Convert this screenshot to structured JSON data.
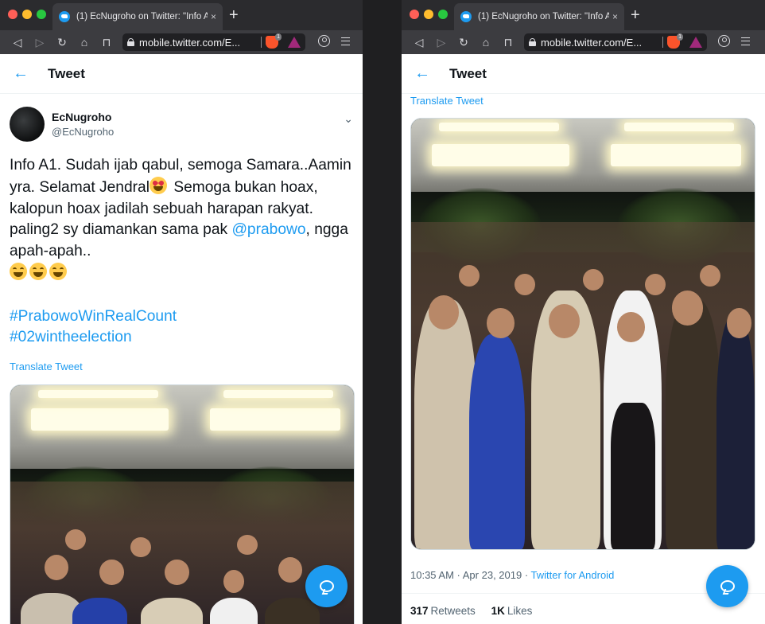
{
  "colors": {
    "twitter_blue": "#1d9bf0",
    "chrome_dark": "#2b2b2e",
    "toolbar": "#3c3c40",
    "text": "#0f1419",
    "secondary": "#536471"
  },
  "browser": {
    "tab_title": "(1) EcNugroho on Twitter: \"Info A",
    "tab_close": "×",
    "new_tab": "+",
    "url": "mobile.twitter.com/E...",
    "brave_badge": "1",
    "icons": [
      "back-icon",
      "forward-icon",
      "reload-icon",
      "home-icon",
      "bookmark-icon",
      "lock-icon",
      "brave-shield-icon",
      "brave-rewards-icon",
      "profile-icon",
      "menu-icon"
    ]
  },
  "header": {
    "back": "←",
    "title": "Tweet"
  },
  "tweet": {
    "display_name": "EcNugroho",
    "handle": "@EcNugroho",
    "caret": "⌄",
    "text_1": "Info A1. Sudah ijab qabul, semoga Samara..Aamin yra. Selamat Jendral",
    "text_2": "Semoga bukan hoax, kalopun hoax jadilah sebuah harapan rakyat. paling2 sy diamankan sama pak ",
    "mention": "@prabowo",
    "text_3": ", ngga apah-apah..",
    "hashtag_1": "#PrabowoWinRealCount",
    "hashtag_2": "#02wintheelection",
    "translate": "Translate Tweet",
    "emoji_heart_eyes": "heart-eyes-emoji",
    "emoji_grin": "grinning-squinting-emoji",
    "timestamp": "10:35 AM · Apr 23, 2019 · ",
    "source": "Twitter for Android",
    "retweets_count": "317",
    "retweets_label": "Retweets",
    "likes_count": "1K",
    "likes_label": "Likes"
  }
}
